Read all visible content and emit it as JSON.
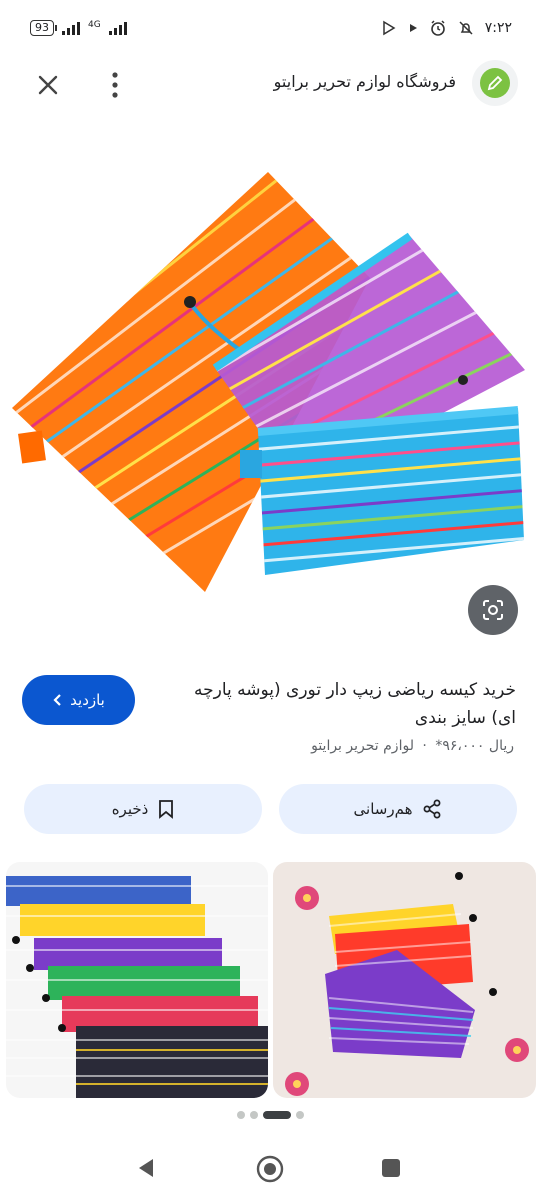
{
  "status_bar": {
    "battery": "93",
    "network": "4G",
    "time": "۷:۲۲"
  },
  "header": {
    "site_name": "فروشگاه لوازم تحریر برایتو",
    "close_icon": "close-icon",
    "more_icon": "more-vert-icon",
    "site_icon": "pencil-icon"
  },
  "product": {
    "title": "خرید کیسه ریاضی زیپ دار توری (پوشه پارچه ای) سایز بندی",
    "price": "ریال ۹۶،۰۰۰*",
    "separator": "·",
    "store": "لوازم تحریر برایتو",
    "visit_label": "بازدید"
  },
  "actions": {
    "share_label": "هم‌رسانی",
    "save_label": "ذخیره"
  },
  "carousel": {
    "total": 4,
    "active_index": 2
  },
  "colors": {
    "accent": "#0b57d0",
    "pill_bg": "#e8f0fe"
  }
}
